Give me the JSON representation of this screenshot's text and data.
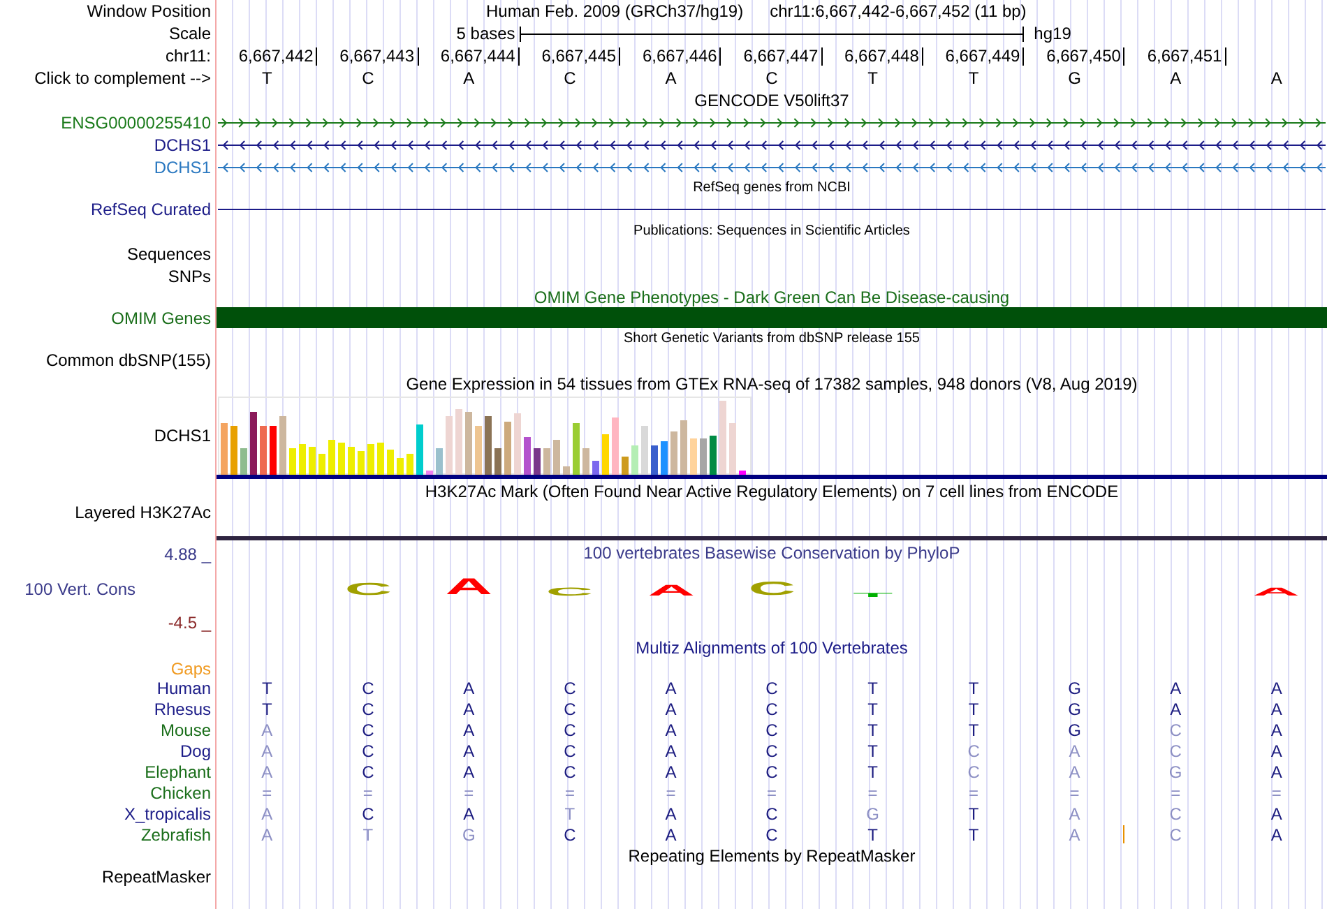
{
  "header": {
    "window_position_label": "Window Position",
    "assembly": "Human Feb. 2009 (GRCh37/hg19)",
    "position": "chr11:6,667,442-6,667,452 (11 bp)"
  },
  "scale": {
    "label": "Scale",
    "bar_label": "5 bases",
    "assembly": "hg19"
  },
  "ruler": {
    "label": "chr11:",
    "positions": [
      "6,667,442",
      "6,667,443",
      "6,667,444",
      "6,667,445",
      "6,667,446",
      "6,667,447",
      "6,667,448",
      "6,667,449",
      "6,667,450",
      "6,667,451"
    ]
  },
  "complement": {
    "label": "Click to complement -->",
    "bases": [
      "T",
      "C",
      "A",
      "C",
      "A",
      "C",
      "T",
      "T",
      "G",
      "A",
      "A"
    ]
  },
  "tracks": [
    {
      "kind": "genes",
      "title": "GENCODE V50lift37",
      "items": [
        {
          "label": "ENSG00000255410",
          "color": "#1a7a1a",
          "kind": "forward"
        },
        {
          "label": "DCHS1",
          "color": "#1c1c88",
          "kind": "reverse"
        },
        {
          "label": "DCHS1",
          "color": "#2a78c0",
          "kind": "reverse"
        }
      ]
    },
    {
      "kind": "line",
      "title": "RefSeq genes from NCBI",
      "items": [
        {
          "label": "RefSeq Curated",
          "color": "#1c1c88"
        }
      ]
    },
    {
      "kind": "labels",
      "title": "Publications: Sequences in Scientific Articles",
      "labels": [
        "Sequences",
        "SNPs"
      ]
    },
    {
      "kind": "bar",
      "title": "OMIM Gene Phenotypes - Dark Green Can Be Disease-causing",
      "label": "OMIM Genes",
      "color": "#00500a"
    },
    {
      "kind": "labels",
      "title": "Short Genetic Variants from dbSNP release 155",
      "labels": [
        "Common dbSNP(155)"
      ]
    },
    {
      "kind": "expression",
      "title": "Gene Expression in 54 tissues from GTEx RNA-seq of 17382 samples, 948 donors (V8, Aug 2019)",
      "label": "DCHS1"
    },
    {
      "kind": "layered",
      "title": "H3K27Ac Mark (Often Found Near Active Regulatory Elements) on 7 cell lines from ENCODE",
      "labels": [
        "Layered H3K27Ac"
      ]
    },
    {
      "kind": "conservation",
      "title": "100 vertebrates Basewise Conservation by PhyloP",
      "label": "100 Vert. Cons",
      "max": "4.88 _",
      "min": "-4.5 _",
      "logo": [
        {
          "kind": "empty"
        },
        {
          "kind": "letter",
          "base": "C",
          "color": "#a0a000"
        },
        {
          "kind": "letter",
          "base": "A",
          "color": "#ff0000"
        },
        {
          "kind": "letter",
          "base": "C",
          "color": "#a0a000"
        },
        {
          "kind": "letter",
          "base": "A",
          "color": "#ff0000"
        },
        {
          "kind": "letter",
          "base": "C",
          "color": "#a0a000"
        },
        {
          "kind": "letter",
          "base": "T",
          "color": "#00b000"
        },
        {
          "kind": "empty"
        },
        {
          "kind": "empty"
        },
        {
          "kind": "empty"
        },
        {
          "kind": "letter",
          "base": "A",
          "color": "#ff0000"
        }
      ]
    },
    {
      "kind": "alignment",
      "title": "Multiz Alignments of 100 Vertebrates",
      "gaps_label": "Gaps",
      "species": [
        {
          "name": "Human",
          "color": "#1c1c88",
          "bases": [
            {
              "base": "T",
              "match": true
            },
            {
              "base": "C",
              "match": true
            },
            {
              "base": "A",
              "match": true
            },
            {
              "base": "C",
              "match": true
            },
            {
              "base": "A",
              "match": true
            },
            {
              "base": "C",
              "match": true
            },
            {
              "base": "T",
              "match": true
            },
            {
              "base": "T",
              "match": true
            },
            {
              "base": "G",
              "match": true
            },
            {
              "base": "A",
              "match": true
            },
            {
              "base": "A",
              "match": true
            }
          ]
        },
        {
          "name": "Rhesus",
          "color": "#1c1c88",
          "bases": [
            {
              "base": "T",
              "match": true
            },
            {
              "base": "C",
              "match": true
            },
            {
              "base": "A",
              "match": true
            },
            {
              "base": "C",
              "match": true
            },
            {
              "base": "A",
              "match": true
            },
            {
              "base": "C",
              "match": true
            },
            {
              "base": "T",
              "match": true
            },
            {
              "base": "T",
              "match": true
            },
            {
              "base": "G",
              "match": true
            },
            {
              "base": "A",
              "match": true
            },
            {
              "base": "A",
              "match": true
            }
          ]
        },
        {
          "name": "Mouse",
          "color": "#1a6e1a",
          "bases": [
            {
              "base": "A",
              "match": false
            },
            {
              "base": "C",
              "match": true
            },
            {
              "base": "A",
              "match": true
            },
            {
              "base": "C",
              "match": true
            },
            {
              "base": "A",
              "match": true
            },
            {
              "base": "C",
              "match": true
            },
            {
              "base": "T",
              "match": true
            },
            {
              "base": "T",
              "match": true
            },
            {
              "base": "G",
              "match": true
            },
            {
              "base": "C",
              "match": false
            },
            {
              "base": "A",
              "match": true
            }
          ]
        },
        {
          "name": "Dog",
          "color": "#1c1c88",
          "bases": [
            {
              "base": "A",
              "match": false
            },
            {
              "base": "C",
              "match": true
            },
            {
              "base": "A",
              "match": true
            },
            {
              "base": "C",
              "match": true
            },
            {
              "base": "A",
              "match": true
            },
            {
              "base": "C",
              "match": true
            },
            {
              "base": "T",
              "match": true
            },
            {
              "base": "C",
              "match": false
            },
            {
              "base": "A",
              "match": false
            },
            {
              "base": "C",
              "match": false
            },
            {
              "base": "A",
              "match": true
            }
          ]
        },
        {
          "name": "Elephant",
          "color": "#1a6e1a",
          "bases": [
            {
              "base": "A",
              "match": false
            },
            {
              "base": "C",
              "match": true
            },
            {
              "base": "A",
              "match": true
            },
            {
              "base": "C",
              "match": true
            },
            {
              "base": "A",
              "match": true
            },
            {
              "base": "C",
              "match": true
            },
            {
              "base": "T",
              "match": true
            },
            {
              "base": "C",
              "match": false
            },
            {
              "base": "A",
              "match": false
            },
            {
              "base": "G",
              "match": false
            },
            {
              "base": "A",
              "match": true
            }
          ]
        },
        {
          "name": "Chicken",
          "color": "#1a6e1a",
          "bases": [
            {
              "base": "=",
              "match": false
            },
            {
              "base": "=",
              "match": false
            },
            {
              "base": "=",
              "match": false
            },
            {
              "base": "=",
              "match": false
            },
            {
              "base": "=",
              "match": false
            },
            {
              "base": "=",
              "match": false
            },
            {
              "base": "=",
              "match": false
            },
            {
              "base": "=",
              "match": false
            },
            {
              "base": "=",
              "match": false
            },
            {
              "base": "=",
              "match": false
            },
            {
              "base": "=",
              "match": false
            }
          ]
        },
        {
          "name": "X_tropicalis",
          "color": "#1c1c88",
          "bases": [
            {
              "base": "A",
              "match": false
            },
            {
              "base": "C",
              "match": true
            },
            {
              "base": "A",
              "match": true
            },
            {
              "base": "T",
              "match": false
            },
            {
              "base": "A",
              "match": true
            },
            {
              "base": "C",
              "match": true
            },
            {
              "base": "G",
              "match": false
            },
            {
              "base": "T",
              "match": true
            },
            {
              "base": "A",
              "match": false
            },
            {
              "base": "C",
              "match": false
            },
            {
              "base": "A",
              "match": true
            }
          ]
        },
        {
          "name": "Zebrafish",
          "color": "#1a6e1a",
          "bases": [
            {
              "base": "A",
              "match": false
            },
            {
              "base": "T",
              "match": false
            },
            {
              "base": "G",
              "match": false
            },
            {
              "base": "C",
              "match": true
            },
            {
              "base": "A",
              "match": true
            },
            {
              "base": "C",
              "match": true
            },
            {
              "base": "T",
              "match": true
            },
            {
              "base": "T",
              "match": true
            },
            {
              "base": "A",
              "match": false,
              "insertion": true
            },
            {
              "base": "C",
              "match": false
            },
            {
              "base": "A",
              "match": true
            }
          ]
        }
      ]
    },
    {
      "kind": "repeats",
      "title": "Repeating Elements by RepeatMasker",
      "labels": [
        "RepeatMasker"
      ]
    }
  ]
}
